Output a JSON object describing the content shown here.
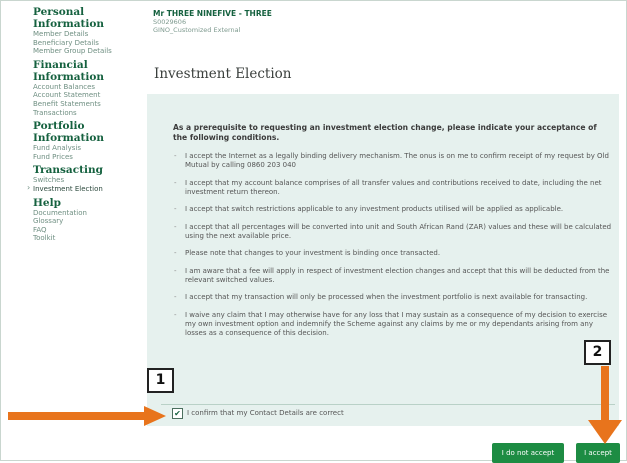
{
  "member": {
    "name": "Mr THREE NINEFIVE - THREE",
    "number": "S0029606",
    "scheme": "GINO_Customized External"
  },
  "sidebar": {
    "sections": [
      {
        "title": "Personal Information",
        "items": [
          "Member Details",
          "Beneficiary Details",
          "Member Group Details"
        ]
      },
      {
        "title": "Financial Information",
        "items": [
          "Account Balances",
          "Account Statement",
          "Benefit Statements",
          "Transactions"
        ]
      },
      {
        "title": "Portfolio Information",
        "items": [
          "Fund Analysis",
          "Fund Prices"
        ]
      },
      {
        "title": "Transacting",
        "items": [
          "Switches",
          "Investment Election"
        ]
      },
      {
        "title": "Help",
        "items": [
          "Documentation",
          "Glossary",
          "FAQ",
          "Toolkit"
        ]
      }
    ],
    "active_item": "Investment Election"
  },
  "page_title": "Investment Election",
  "intro": "As a prerequisite to requesting an investment election change, please indicate your acceptance of the following conditions.",
  "conditions": [
    "I accept the Internet as a legally binding delivery mechanism. The onus is on me to confirm receipt of my request by Old Mutual by calling 0860 203 040",
    "I accept that my account balance comprises of all transfer values and contributions received to date, including the net investment return thereon.",
    "I accept that switch restrictions applicable to any investment products utilised will be applied as applicable.",
    "I accept that all percentages will be converted into unit and South African Rand (ZAR) values and these will be calculated using the next available price.",
    "Please note that changes to your investment is binding once transacted.",
    "I am aware that a fee will apply in respect of investment election changes and accept that this will be deducted from the relevant switched values.",
    "I accept that my transaction will only be processed when the investment portfolio is next available for transacting.",
    "I waive any claim that I may otherwise have for any loss that I may sustain as a consequence of my decision to exercise my own investment option and indemnify the Scheme against any claims by me or my dependants arising from any losses as a consequence of this decision."
  ],
  "confirm": {
    "label": "I confirm that my Contact Details are correct",
    "checked": true,
    "check_glyph": "✔"
  },
  "buttons": {
    "decline_label": "I do not accept",
    "accept_label": "I accept"
  },
  "annotations": {
    "step1": "1",
    "step2": "2",
    "arrow_color": "#e8741c"
  },
  "colors": {
    "brand_green": "#15613f",
    "button_green": "#1d8c43",
    "panel_bg": "#e6f1ee"
  }
}
